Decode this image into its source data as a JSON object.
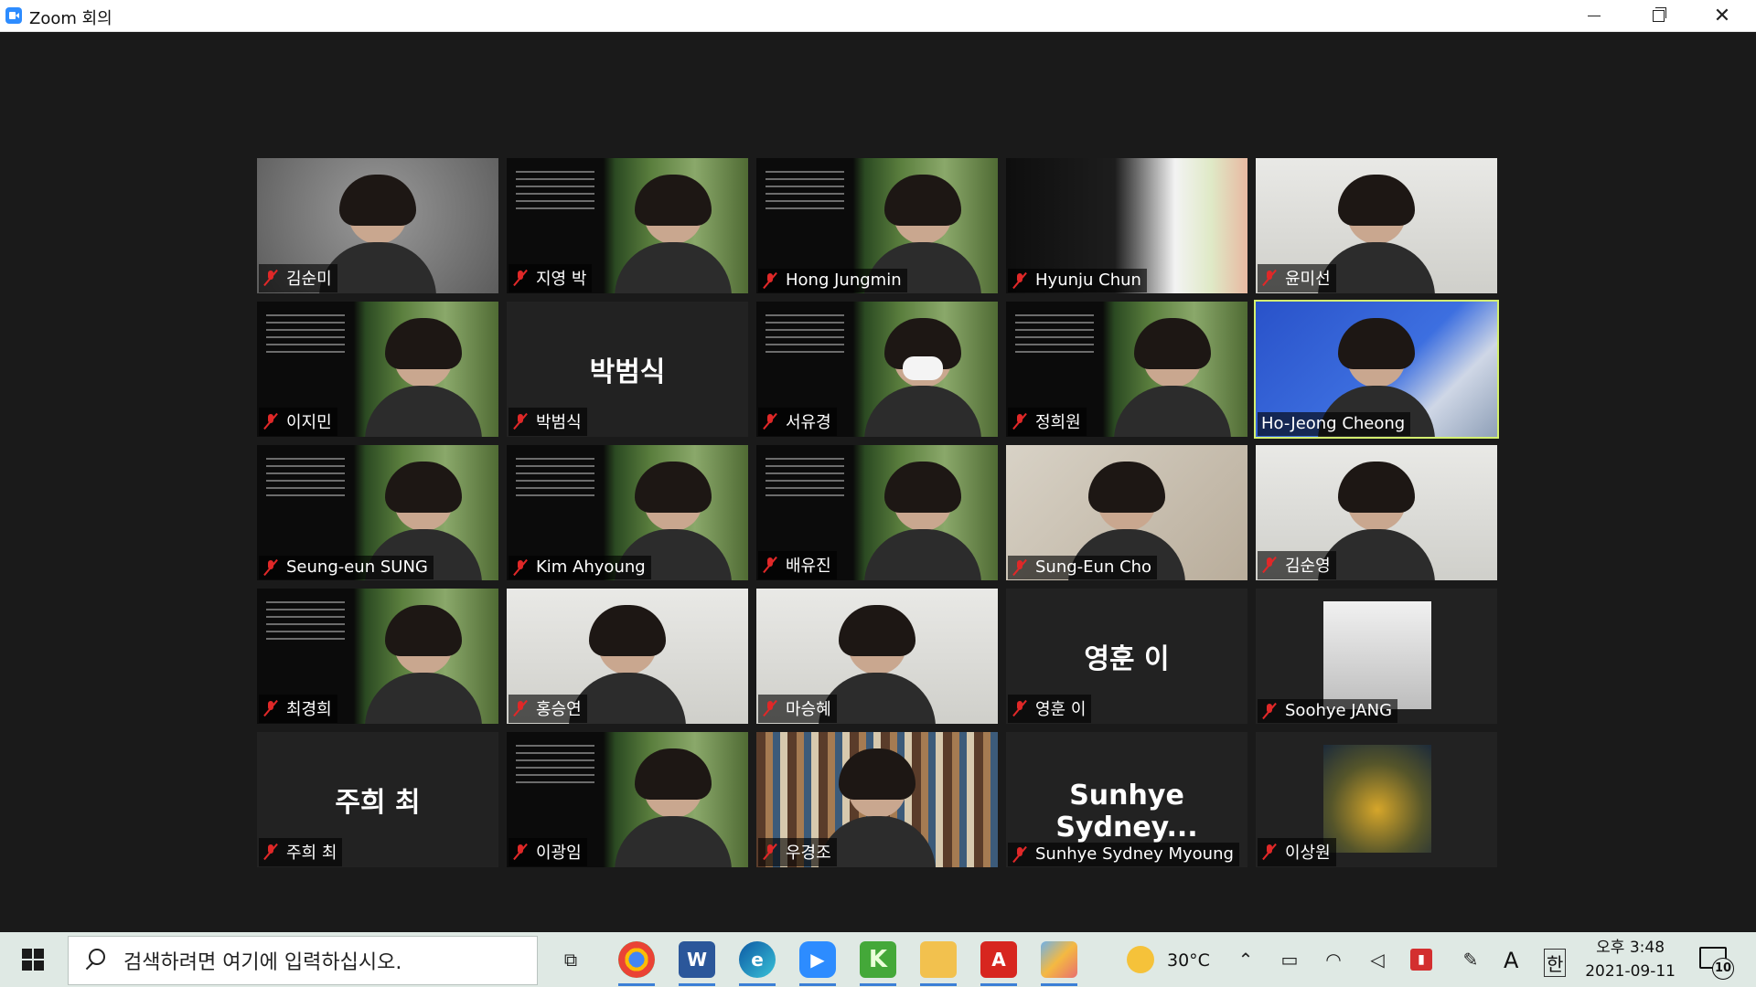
{
  "window": {
    "title": "Zoom 회의"
  },
  "participants": [
    {
      "name": "김순미",
      "video": "room-gray",
      "muted": true
    },
    {
      "name": "지영 박",
      "video": "slide",
      "muted": true
    },
    {
      "name": "Hong Jungmin",
      "video": "slide",
      "muted": true
    },
    {
      "name": "Hyunju Chun",
      "video": "hyunju",
      "muted": true
    },
    {
      "name": "윤미선",
      "video": "room-light",
      "muted": true
    },
    {
      "name": "이지민",
      "video": "slide",
      "muted": true
    },
    {
      "name": "박범식",
      "video": "name",
      "display": "박범식",
      "muted": true
    },
    {
      "name": "서유경",
      "video": "slide",
      "muted": true,
      "mask": true
    },
    {
      "name": "정희원",
      "video": "slide",
      "muted": true
    },
    {
      "name": "Ho-Jeong Cheong",
      "video": "blue",
      "muted": false,
      "active": true
    },
    {
      "name": "Seung-eun SUNG",
      "video": "slide",
      "muted": true
    },
    {
      "name": "Kim Ahyoung",
      "video": "slide",
      "muted": true
    },
    {
      "name": "배유진",
      "video": "slide",
      "muted": true
    },
    {
      "name": "Sung-Eun Cho",
      "video": "room-warm",
      "muted": true
    },
    {
      "name": "김순영",
      "video": "room-light",
      "muted": true
    },
    {
      "name": "최경희",
      "video": "slide",
      "muted": true
    },
    {
      "name": "홍승연",
      "video": "room-light",
      "muted": true
    },
    {
      "name": "마승혜",
      "video": "room-light",
      "muted": true
    },
    {
      "name": "영훈 이",
      "video": "name",
      "display": "영훈 이",
      "muted": true
    },
    {
      "name": "Soohye JANG",
      "video": "sketch",
      "muted": true
    },
    {
      "name": "주희 최",
      "video": "name",
      "display": "주희 최",
      "muted": true
    },
    {
      "name": "이광임",
      "video": "slide",
      "muted": true
    },
    {
      "name": "우경조",
      "video": "library",
      "muted": true
    },
    {
      "name": "Sunhye Sydney Myoung",
      "video": "name",
      "display": "Sunhye  Sydney...",
      "muted": true
    },
    {
      "name": "이상원",
      "video": "photo-yellow",
      "muted": true
    }
  ],
  "taskbar": {
    "search_placeholder": "검색하려면 여기에 입력하십시오.",
    "weather": "30°C",
    "ime_mode": "A",
    "ime_lang": "한",
    "time": "오후 3:48",
    "date": "2021-09-11",
    "notification_count": "10"
  },
  "colors": {
    "active_speaker_border": "#d4f070",
    "muted_icon": "#e02828",
    "taskbar_bg": "#dfe9e4",
    "stage_bg": "#1a1a1a"
  }
}
